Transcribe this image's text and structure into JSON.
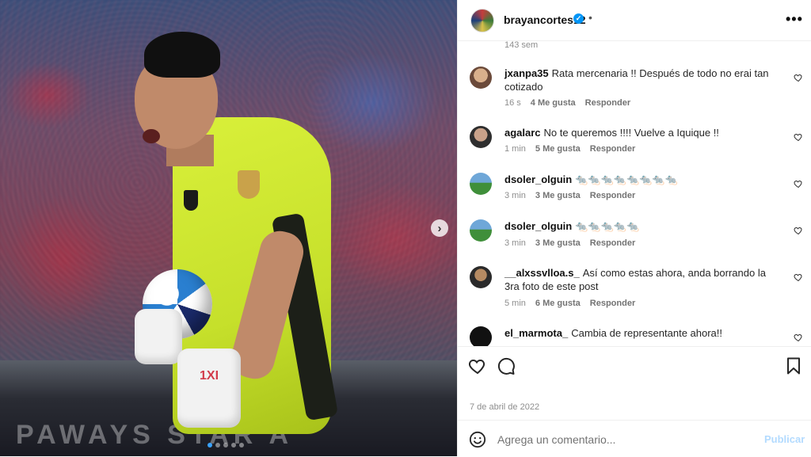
{
  "media": {
    "board_text": "PAWAYS STAR A",
    "glove_text": "1XI",
    "carousel": {
      "count": 5,
      "active": 0
    }
  },
  "post": {
    "username": "brayancortes12",
    "verified_mark": "✓",
    "separator": "•",
    "more_icon": "more-icon",
    "prev_time": "143 sem"
  },
  "comments": [
    {
      "user": "jxanpa35",
      "text": "Rata mercenaria !! Después de todo no erai tan cotizado",
      "time": "16 s",
      "likes": "4 Me gusta",
      "reply": "Responder"
    },
    {
      "user": "agalarc",
      "text": "No te queremos !!!! Vuelve a Iquique !!",
      "time": "1 min",
      "likes": "5 Me gusta",
      "reply": "Responder"
    },
    {
      "user": "dsoler_olguin",
      "text": "🐀🐀🐀🐀🐀🐀🐀🐀",
      "time": "3 min",
      "likes": "3 Me gusta",
      "reply": "Responder"
    },
    {
      "user": "dsoler_olguin",
      "text": "🐀🐀🐀🐀🐀",
      "time": "3 min",
      "likes": "3 Me gusta",
      "reply": "Responder"
    },
    {
      "user": "__alxssvlloa.s_",
      "text": "Así como estas ahora, anda borrando la 3ra foto de este post",
      "time": "5 min",
      "likes": "6 Me gusta",
      "reply": "Responder"
    },
    {
      "user": "el_marmota_",
      "text": "Cambia de representante ahora!!",
      "time": "",
      "likes": "",
      "reply": ""
    }
  ],
  "footer": {
    "date": "7 de abril de 2022",
    "comment_placeholder": "Agrega un comentario...",
    "publish_label": "Publicar"
  },
  "colors": {
    "accent": "#0095f6",
    "publish_disabled": "#b3dbff",
    "muted": "#8e8e8e"
  }
}
